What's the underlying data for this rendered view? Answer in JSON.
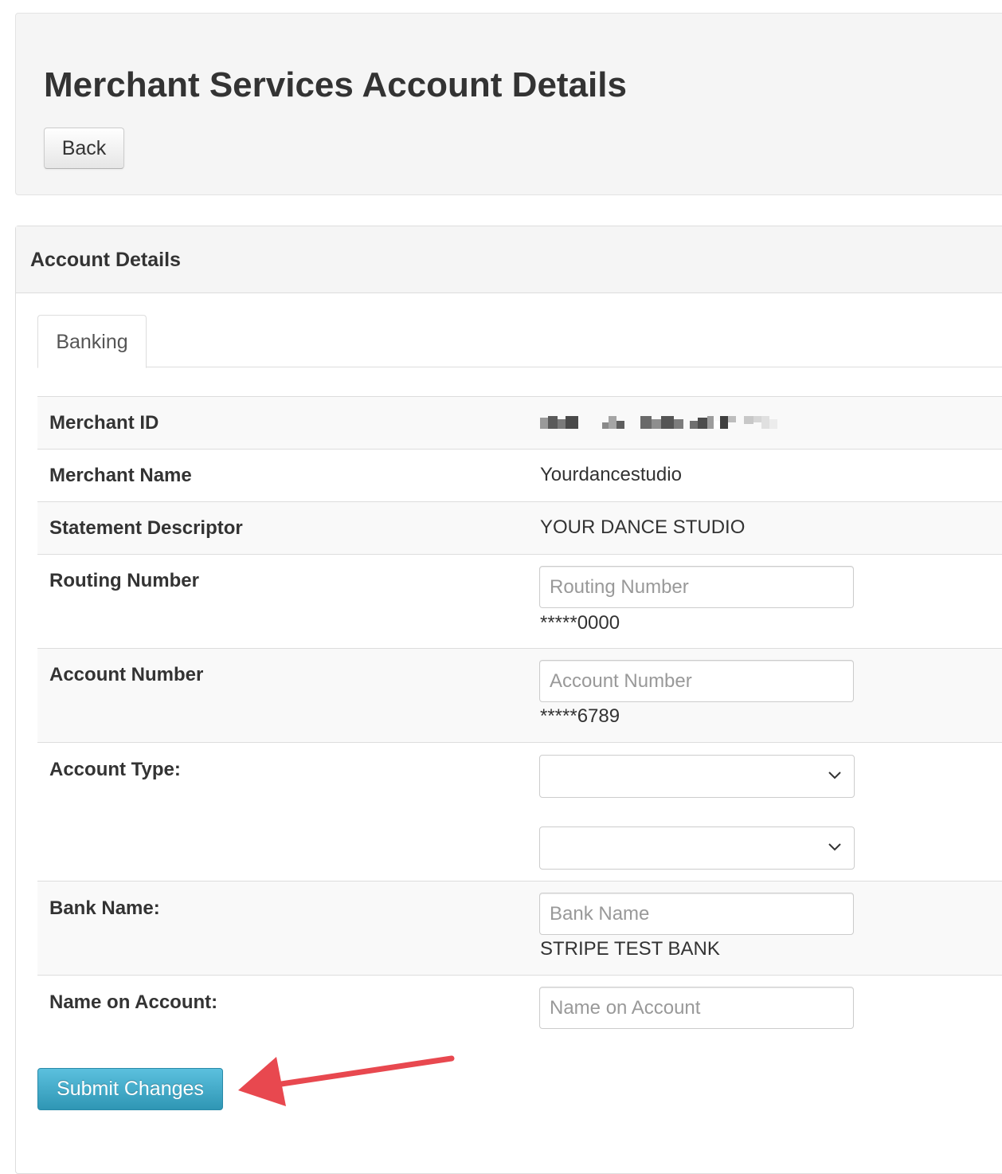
{
  "header": {
    "title": "Merchant Services Account Details",
    "back_label": "Back"
  },
  "panel": {
    "title": "Account Details",
    "tabs": [
      {
        "label": "Banking",
        "active": true
      }
    ]
  },
  "rows": {
    "merchant_id": {
      "label": "Merchant ID",
      "value_redacted": true
    },
    "merchant_name": {
      "label": "Merchant Name",
      "value": "Yourdancestudio"
    },
    "statement_descriptor": {
      "label": "Statement Descriptor",
      "value": "YOUR DANCE STUDIO"
    },
    "routing_number": {
      "label": "Routing Number",
      "placeholder": "Routing Number",
      "input_value": "",
      "current": "*****0000"
    },
    "account_number": {
      "label": "Account Number",
      "placeholder": "Account Number",
      "input_value": "",
      "current": "*****6789"
    },
    "account_type": {
      "label": "Account Type:",
      "select1_value": "",
      "select2_value": ""
    },
    "bank_name": {
      "label": "Bank Name:",
      "placeholder": "Bank Name",
      "input_value": "",
      "current": "STRIPE TEST BANK"
    },
    "name_on_account": {
      "label": "Name on Account:",
      "placeholder": "Name on Account",
      "input_value": ""
    }
  },
  "actions": {
    "submit_label": "Submit Changes"
  },
  "annotation": {
    "arrow_color": "#e8484f"
  },
  "colors": {
    "submit_button": "#2f96b4",
    "header_background": "#f5f5f5"
  }
}
